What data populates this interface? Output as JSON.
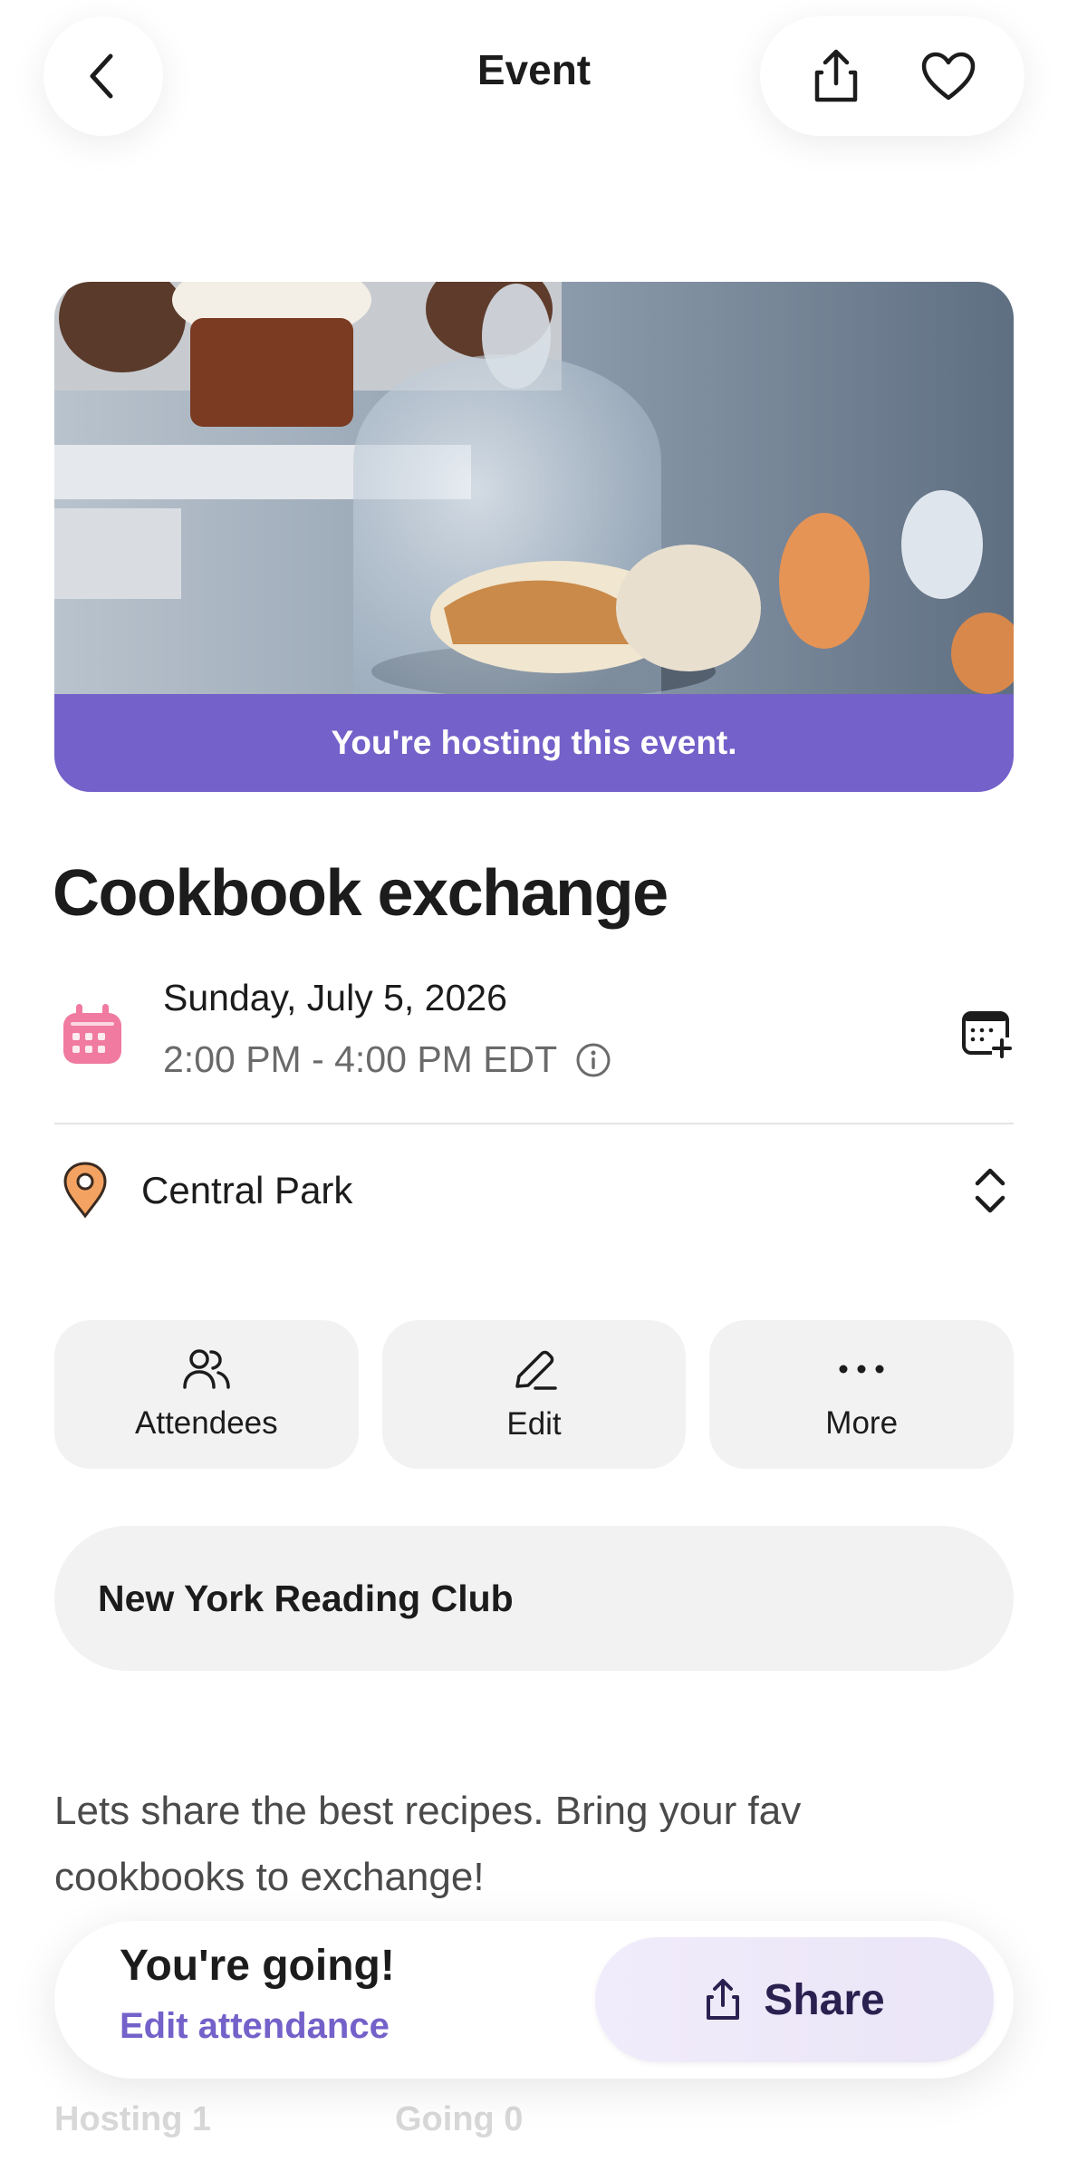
{
  "header": {
    "title": "Event"
  },
  "hero": {
    "banner_text": "You're hosting this event."
  },
  "event": {
    "title": "Cookbook exchange",
    "date": "Sunday, July 5, 2026",
    "time": "2:00 PM - 4:00 PM EDT",
    "location": "Central Park",
    "group": "New York Reading Club",
    "description": "Lets share the best recipes. Bring your fav cookbooks to exchange!"
  },
  "actions": [
    {
      "label": "Attendees",
      "icon": "people-icon"
    },
    {
      "label": "Edit",
      "icon": "pencil-icon"
    },
    {
      "label": "More",
      "icon": "more-icon"
    }
  ],
  "stats": {
    "hosting": "Hosting 1",
    "going": "Going 0"
  },
  "bottom_bar": {
    "status": "You're going!",
    "edit_link": "Edit attendance",
    "share_label": "Share"
  },
  "colors": {
    "accent": "#7461c9",
    "calendar_icon": "#f07aa0",
    "pin_icon": "#f4a261",
    "card_bg": "#f2f2f2"
  }
}
